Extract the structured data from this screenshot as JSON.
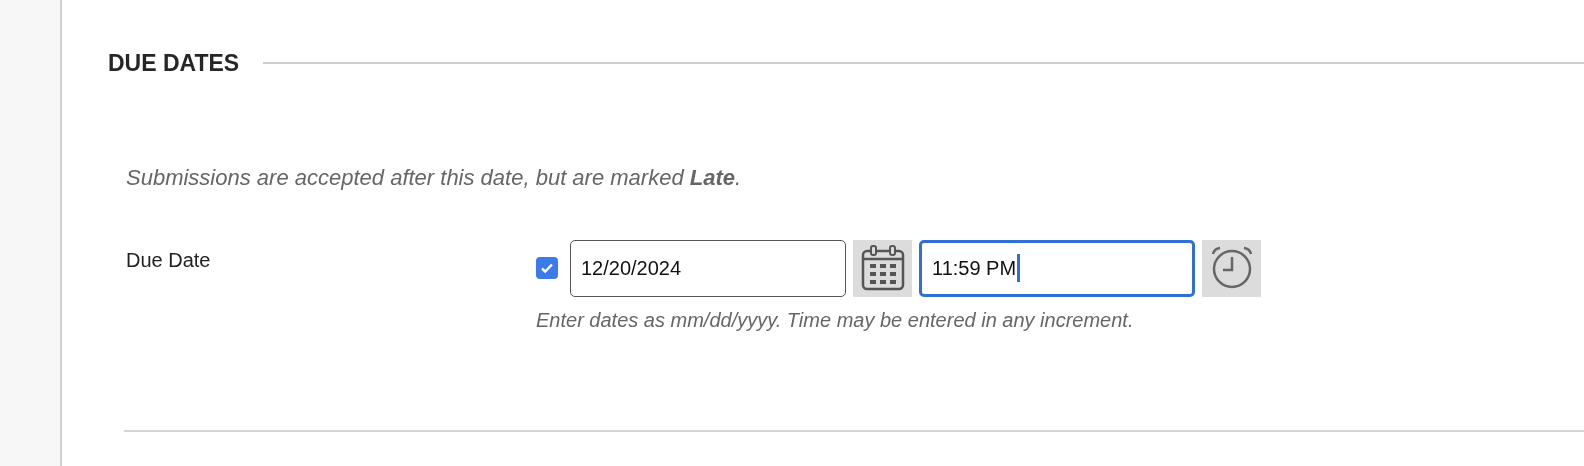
{
  "section": {
    "title": "DUE DATES"
  },
  "note": "Submissions are accepted after this date, but are marked **Late**.",
  "due_date": {
    "label": "Due Date",
    "enabled": true,
    "date": {
      "value": "12/20/2024",
      "focused": false
    },
    "time": {
      "value": "11:59 PM",
      "focused": true
    },
    "hint": "Enter dates as mm/dd/yyyy. Time may be entered in any increment."
  }
}
